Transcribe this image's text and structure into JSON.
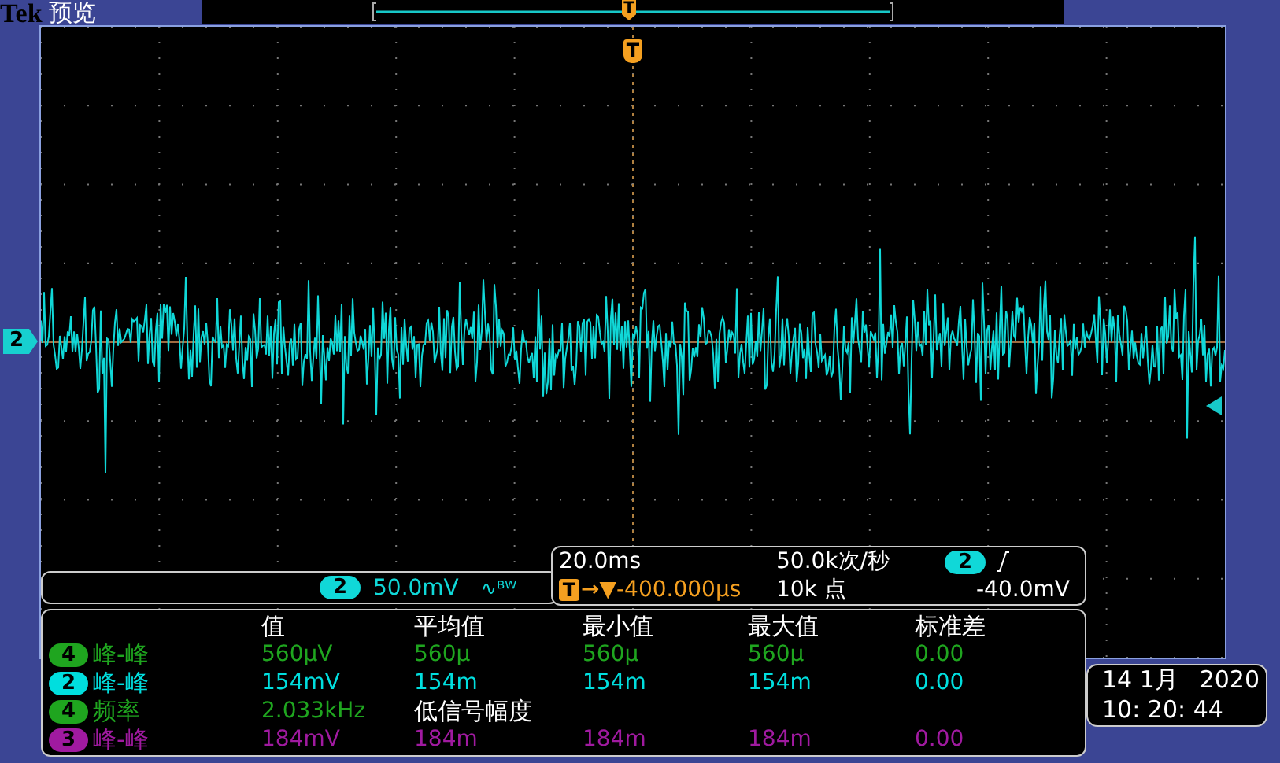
{
  "header": {
    "brand": "Tek",
    "mode": "预览"
  },
  "record_bar": {
    "trigger_label": "T"
  },
  "graticule": {
    "trigger_label": "T",
    "channel_marker": "2"
  },
  "channel_readout": {
    "channel": "2",
    "scale": "50.0mV",
    "bandwidth": "∿ᴮᵂ"
  },
  "timebase": {
    "horizontal_scale": "20.0ms",
    "sample_rate": "50.0k次/秒",
    "trigger_channel": "2",
    "trigger_label": "T",
    "trigger_arrow": "→▼",
    "position": "-400.000µs",
    "record_length": "10k 点",
    "trigger_level": "-40.0mV"
  },
  "measurements": {
    "columns": [
      "值",
      "平均值",
      "最小值",
      "最大值",
      "标准差"
    ],
    "rows": [
      {
        "channel": "4",
        "label": "峰-峰",
        "color": "#1fa51f",
        "values": [
          "560µV",
          "560µ",
          "560µ",
          "560µ",
          "0.00"
        ]
      },
      {
        "channel": "2",
        "label": "峰-峰",
        "color": "#00dede",
        "values": [
          "154mV",
          "154m",
          "154m",
          "154m",
          "0.00"
        ]
      },
      {
        "channel": "4",
        "label": "频率",
        "color": "#1fa51f",
        "values": [
          "2.033kHz"
        ],
        "note": "低信号幅度"
      },
      {
        "channel": "3",
        "label": "峰-峰",
        "color": "#a01aa0",
        "values": [
          "184mV",
          "184m",
          "184m",
          "184m",
          "0.00"
        ]
      }
    ]
  },
  "clock": {
    "date": "14 1月",
    "year": "2020",
    "time": "10: 20: 44"
  }
}
